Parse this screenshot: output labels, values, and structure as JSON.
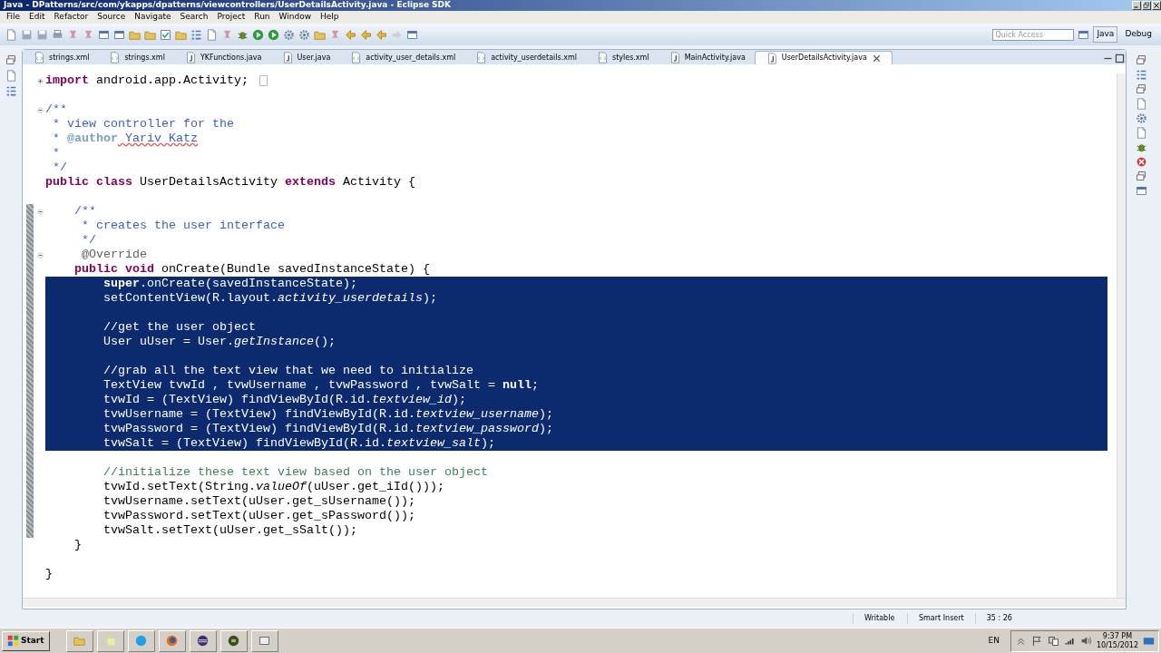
{
  "window": {
    "title": "Java - DPatterns/src/com/ykapps/dpatterns/viewcontrollers/UserDetailsActivity.java - Eclipse SDK"
  },
  "menu": [
    "File",
    "Edit",
    "Refactor",
    "Source",
    "Navigate",
    "Search",
    "Project",
    "Run",
    "Window",
    "Help"
  ],
  "quick_access": {
    "placeholder": "Quick Access"
  },
  "perspectives": [
    {
      "label": "Java",
      "selected": true
    },
    {
      "label": "Debug",
      "selected": false
    }
  ],
  "tabs": [
    {
      "label": "strings.xml",
      "kind": "xml",
      "selected": false
    },
    {
      "label": "strings.xml",
      "kind": "xml",
      "selected": false
    },
    {
      "label": "YKFunctions.java",
      "kind": "java",
      "selected": false
    },
    {
      "label": "User.java",
      "kind": "java",
      "selected": false
    },
    {
      "label": "activity_user_details.xml",
      "kind": "xml",
      "selected": false
    },
    {
      "label": "activity_userdetails.xml",
      "kind": "xml",
      "selected": false
    },
    {
      "label": "styles.xml",
      "kind": "xml",
      "selected": false
    },
    {
      "label": "MainActivity.java",
      "kind": "java",
      "selected": false
    },
    {
      "label": "UserDetailsActivity.java",
      "kind": "java",
      "selected": true
    }
  ],
  "editor": {
    "lines": [
      {
        "fold_marker": true,
        "collapsed": true,
        "selected": false,
        "changed": false,
        "folded_marker": true,
        "tokens": [
          {
            "kind": "keyword",
            "text": "import"
          },
          {
            "kind": "plain",
            "text": " android.app.Activity;"
          }
        ]
      },
      {
        "selected": false,
        "changed": false
      },
      {
        "fold_marker": true,
        "collapsed": false,
        "selected": false,
        "changed": false,
        "tokens": [
          {
            "kind": "javadoc",
            "text": "/**"
          }
        ]
      },
      {
        "selected": false,
        "changed": false,
        "tokens": [
          {
            "kind": "javadoc",
            "text": " * view controller for the"
          }
        ]
      },
      {
        "selected": false,
        "changed": false,
        "tokens": [
          {
            "kind": "javadoc",
            "text": " * "
          },
          {
            "kind": "javadoc_tag",
            "text": "@author"
          },
          {
            "kind": "misspelled",
            "text": " Yariv Katz"
          }
        ]
      },
      {
        "selected": false,
        "changed": false,
        "tokens": [
          {
            "kind": "javadoc",
            "text": " *"
          }
        ]
      },
      {
        "selected": false,
        "changed": false,
        "tokens": [
          {
            "kind": "javadoc",
            "text": " */"
          }
        ]
      },
      {
        "selected": false,
        "changed": false,
        "tokens": [
          {
            "kind": "keyword",
            "text": "public class"
          },
          {
            "kind": "plain",
            "text": " UserDetailsActivity "
          },
          {
            "kind": "keyword",
            "text": "extends"
          },
          {
            "kind": "plain",
            "text": " Activity {"
          }
        ]
      },
      {
        "selected": false,
        "changed": false
      },
      {
        "fold_marker": true,
        "collapsed": false,
        "selected": false,
        "changed": true,
        "tokens": [
          {
            "kind": "javadoc",
            "text": "    /**"
          }
        ]
      },
      {
        "selected": false,
        "changed": true,
        "tokens": [
          {
            "kind": "javadoc",
            "text": "     * creates the user interface"
          }
        ]
      },
      {
        "selected": false,
        "changed": true,
        "tokens": [
          {
            "kind": "javadoc",
            "text": "     */"
          }
        ]
      },
      {
        "fold_marker": true,
        "collapsed": false,
        "selected": false,
        "changed": true,
        "tokens": [
          {
            "kind": "annotation",
            "text": "     @Override"
          }
        ]
      },
      {
        "selected": false,
        "changed": true,
        "tokens": [
          {
            "kind": "keyword",
            "text": "    public void"
          },
          {
            "kind": "plain",
            "text": " onCreate(Bundle savedInstanceState) {"
          }
        ]
      },
      {
        "selected": true,
        "changed": true,
        "tokens": [
          {
            "kind": "keyword",
            "text": "        super"
          },
          {
            "kind": "plain",
            "text": ".onCreate(savedInstanceState);"
          }
        ]
      },
      {
        "selected": true,
        "changed": true,
        "tokens": [
          {
            "kind": "plain",
            "text": "        setContentView(R.layout."
          },
          {
            "kind": "static_field",
            "text": "activity_userdetails"
          },
          {
            "kind": "plain",
            "text": ");"
          }
        ]
      },
      {
        "selected": true,
        "changed": true
      },
      {
        "selected": true,
        "changed": true,
        "tokens": [
          {
            "kind": "line_comment",
            "text": "        //get the user object"
          }
        ]
      },
      {
        "selected": true,
        "changed": true,
        "tokens": [
          {
            "kind": "plain",
            "text": "        User uUser = User."
          },
          {
            "kind": "static_method",
            "text": "getInstance"
          },
          {
            "kind": "plain",
            "text": "();"
          }
        ]
      },
      {
        "selected": true,
        "changed": true
      },
      {
        "selected": true,
        "changed": true,
        "tokens": [
          {
            "kind": "line_comment",
            "text": "        //grab all the text view that we need to initialize"
          }
        ]
      },
      {
        "selected": true,
        "changed": true,
        "tokens": [
          {
            "kind": "plain",
            "text": "        TextView tvwId , tvwUsername , tvwPassword , tvwSalt = "
          },
          {
            "kind": "keyword",
            "text": "null"
          },
          {
            "kind": "plain",
            "text": ";"
          }
        ]
      },
      {
        "selected": true,
        "changed": true,
        "tokens": [
          {
            "kind": "plain",
            "text": "        tvwId = (TextView) findViewById(R.id."
          },
          {
            "kind": "static_field",
            "text": "textview_id"
          },
          {
            "kind": "plain",
            "text": ");"
          }
        ]
      },
      {
        "selected": true,
        "changed": true,
        "tokens": [
          {
            "kind": "plain",
            "text": "        tvwUsername = (TextView) findViewById(R.id."
          },
          {
            "kind": "static_field",
            "text": "textview_username"
          },
          {
            "kind": "plain",
            "text": ");"
          }
        ]
      },
      {
        "selected": true,
        "changed": true,
        "tokens": [
          {
            "kind": "plain",
            "text": "        tvwPassword = (TextView) findViewById(R.id."
          },
          {
            "kind": "static_field",
            "text": "textview_password"
          },
          {
            "kind": "plain",
            "text": ");"
          }
        ]
      },
      {
        "selected": true,
        "changed": true,
        "tokens": [
          {
            "kind": "plain",
            "text": "        tvwSalt = (TextView) findViewById(R.id."
          },
          {
            "kind": "static_field",
            "text": "textview_salt"
          },
          {
            "kind": "plain",
            "text": ");"
          }
        ]
      },
      {
        "selected": false,
        "changed": true
      },
      {
        "selected": false,
        "changed": true,
        "tokens": [
          {
            "kind": "line_comment",
            "text": "        //initialize these text view based on the user object"
          }
        ]
      },
      {
        "selected": false,
        "changed": true,
        "tokens": [
          {
            "kind": "plain",
            "text": "        tvwId.setText(String."
          },
          {
            "kind": "static_method",
            "text": "valueOf"
          },
          {
            "kind": "plain",
            "text": "(uUser.get_iId()));"
          }
        ]
      },
      {
        "selected": false,
        "changed": true,
        "tokens": [
          {
            "kind": "plain",
            "text": "        tvwUsername.setText(uUser.get_sUsername());"
          }
        ]
      },
      {
        "selected": false,
        "changed": true,
        "tokens": [
          {
            "kind": "plain",
            "text": "        tvwPassword.setText(uUser.get_sPassword());"
          }
        ]
      },
      {
        "selected": false,
        "changed": true,
        "tokens": [
          {
            "kind": "plain",
            "text": "        tvwSalt.setText(uUser.get_sSalt());"
          }
        ]
      },
      {
        "selected": false,
        "changed": false,
        "tokens": [
          {
            "kind": "plain",
            "text": "    }"
          }
        ]
      },
      {
        "selected": false,
        "changed": false
      },
      {
        "selected": false,
        "changed": false,
        "tokens": [
          {
            "kind": "plain",
            "text": "}"
          }
        ]
      }
    ]
  },
  "status_bar": [
    "Writable",
    "Smart Insert",
    "35 : 26"
  ],
  "taskbar": {
    "start": "Start",
    "language": "EN",
    "time": "9:37 PM",
    "date": "10/15/2012"
  }
}
